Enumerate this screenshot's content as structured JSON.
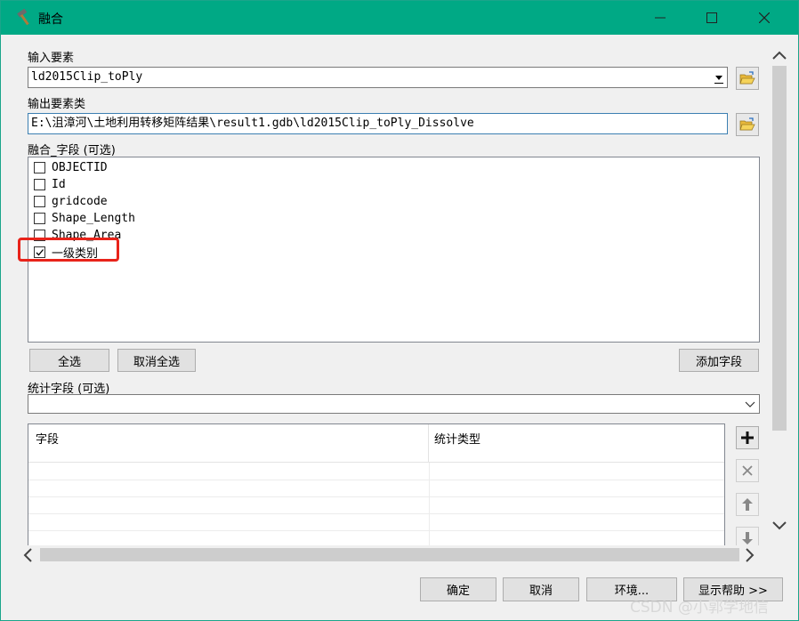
{
  "window": {
    "title": "融合",
    "accent_color": "#00a985",
    "icon": "hammer-icon"
  },
  "input_features": {
    "label": "输入要素",
    "value": "ld2015Clip_toPly"
  },
  "output_feature_class": {
    "label": "输出要素类",
    "value": "E:\\沮漳河\\土地利用转移矩阵结果\\result1.gdb\\ld2015Clip_toPly_Dissolve"
  },
  "dissolve_fields": {
    "label": "融合_字段 (可选)",
    "items": [
      {
        "name": "OBJECTID",
        "checked": false
      },
      {
        "name": "Id",
        "checked": false
      },
      {
        "name": "gridcode",
        "checked": false
      },
      {
        "name": "Shape_Length",
        "checked": false
      },
      {
        "name": "Shape_Area",
        "checked": false
      },
      {
        "name": "一级类别",
        "checked": true
      }
    ],
    "select_all": "全选",
    "unselect_all": "取消全选",
    "add_field": "添加字段"
  },
  "statistics_fields": {
    "label": "统计字段 (可选)",
    "columns": [
      "字段",
      "统计类型"
    ]
  },
  "footer": {
    "ok": "确定",
    "cancel": "取消",
    "environments": "环境...",
    "show_help": "显示帮助 >>"
  },
  "watermark": "CSDN @小郭学地信",
  "highlight_color": "#e8231a"
}
